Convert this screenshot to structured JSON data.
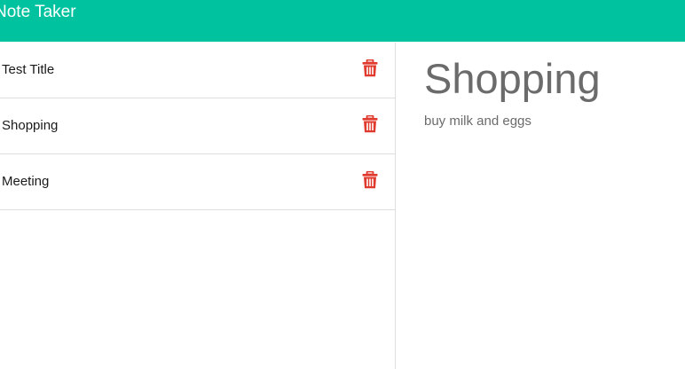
{
  "app": {
    "title": "Note Taker",
    "accent_color": "#00c29f",
    "delete_color": "#e03a2f"
  },
  "notes": [
    {
      "title": "Test Title",
      "icon": "trash-icon"
    },
    {
      "title": "Shopping",
      "icon": "trash-icon"
    },
    {
      "title": "Meeting",
      "icon": "trash-icon"
    }
  ],
  "active_note": {
    "title": "Shopping",
    "text": "buy milk and eggs"
  }
}
